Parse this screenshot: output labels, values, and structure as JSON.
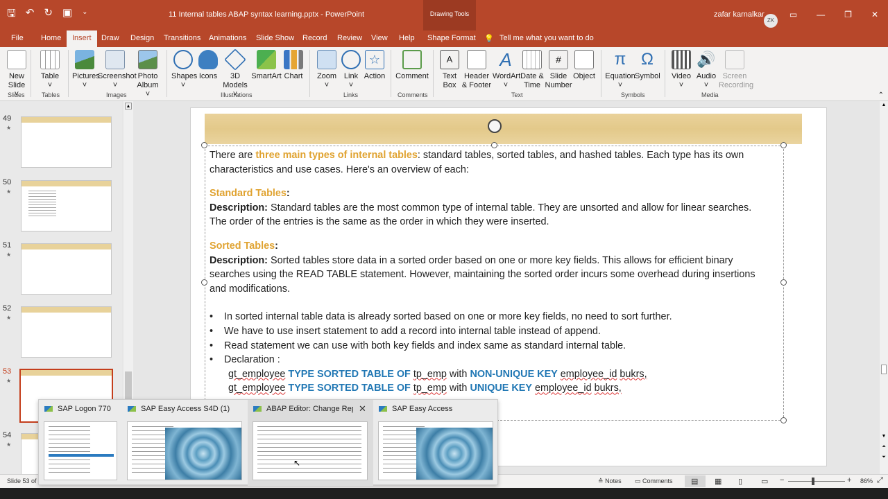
{
  "window": {
    "title": "11 Internal tables ABAP syntax learning.pptx  -  PowerPoint",
    "drawing_tools": "Drawing Tools",
    "user_name": "zafar karnalkar",
    "user_initials": "ZK"
  },
  "tabs": [
    "File",
    "Home",
    "Insert",
    "Draw",
    "Design",
    "Transitions",
    "Animations",
    "Slide Show",
    "Record",
    "Review",
    "View",
    "Help",
    "Shape Format"
  ],
  "tell_me": "Tell me what you want to do",
  "ribbon": {
    "buttons": [
      {
        "l1": "New",
        "l2": "Slide ˅"
      },
      {
        "l1": "Table",
        "l2": "˅"
      },
      {
        "l1": "Pictures",
        "l2": "˅"
      },
      {
        "l1": "Screenshot",
        "l2": "˅"
      },
      {
        "l1": "Photo",
        "l2": "Album ˅"
      },
      {
        "l1": "Shapes",
        "l2": "˅"
      },
      {
        "l1": "Icons",
        "l2": ""
      },
      {
        "l1": "3D",
        "l2": "Models ˅"
      },
      {
        "l1": "SmartArt",
        "l2": ""
      },
      {
        "l1": "Chart",
        "l2": ""
      },
      {
        "l1": "Zoom",
        "l2": "˅"
      },
      {
        "l1": "Link",
        "l2": "˅"
      },
      {
        "l1": "Action",
        "l2": ""
      },
      {
        "l1": "Comment",
        "l2": ""
      },
      {
        "l1": "Text",
        "l2": "Box"
      },
      {
        "l1": "Header",
        "l2": "& Footer"
      },
      {
        "l1": "WordArt",
        "l2": "˅"
      },
      {
        "l1": "Date &",
        "l2": "Time"
      },
      {
        "l1": "Slide",
        "l2": "Number"
      },
      {
        "l1": "Object",
        "l2": ""
      },
      {
        "l1": "Equation",
        "l2": "˅"
      },
      {
        "l1": "Symbol",
        "l2": ""
      },
      {
        "l1": "Video",
        "l2": "˅"
      },
      {
        "l1": "Audio",
        "l2": "˅"
      },
      {
        "l1": "Screen",
        "l2": "Recording"
      }
    ],
    "groups": [
      "Slides",
      "Tables",
      "Images",
      "Illustrations",
      "Links",
      "Comments",
      "Text",
      "Symbols",
      "Media"
    ]
  },
  "thumbnails": [
    {
      "num": "49"
    },
    {
      "num": "50"
    },
    {
      "num": "51"
    },
    {
      "num": "52"
    },
    {
      "num": "53"
    },
    {
      "num": "54"
    }
  ],
  "slide": {
    "p1_a": "There are ",
    "p1_b": "three main types of internal tables",
    "p1_c": ": standard tables, sorted tables, and hashed tables. Each type has its own characteristics and use cases. Here's an overview of each:",
    "h_standard": "Standard Tables",
    "colon": ":",
    "desc_label": "Description:",
    "standard_desc": " Standard tables are the most common type of internal table. They are unsorted and allow for linear searches. The order of the entries is the same as the order in which they were inserted.",
    "h_sorted": "Sorted Tables",
    "sorted_desc": " Sorted tables store data in a sorted order based on one or more key fields. This allows for efficient binary searches using the READ TABLE statement. However, maintaining the sorted order incurs some overhead during insertions and modifications.",
    "bullets": [
      "In sorted internal table data is already sorted based on one or more key fields, no need to sort further.",
      "We have to use insert statement to add a record into internal table instead of append.",
      "Read statement we can use with both key fields and index same as standard internal table.",
      "Declaration :"
    ],
    "code1": {
      "a": "gt_employee",
      "b": "TYPE SORTED TABLE OF",
      "c": "tp_emp",
      "d": "with",
      "e": "NON-UNIQUE KEY",
      "f": "employee_id",
      "g": "bukrs,"
    },
    "code2": {
      "a": "gt_employee",
      "b": "TYPE SORTED TABLE OF",
      "c": "tp_emp",
      "d": "with",
      "e": "UNIQUE KEY",
      "f": "employee_id",
      "g": "bukrs,"
    }
  },
  "taskbar_previews": [
    "SAP Logon 770",
    "SAP Easy Access S4D (1)",
    "ABAP Editor: Change Rep...",
    "SAP Easy Access"
  ],
  "status": {
    "slide_info": "Slide 53 of",
    "notes": "Notes",
    "comments": "Comments",
    "zoom": "86%"
  }
}
